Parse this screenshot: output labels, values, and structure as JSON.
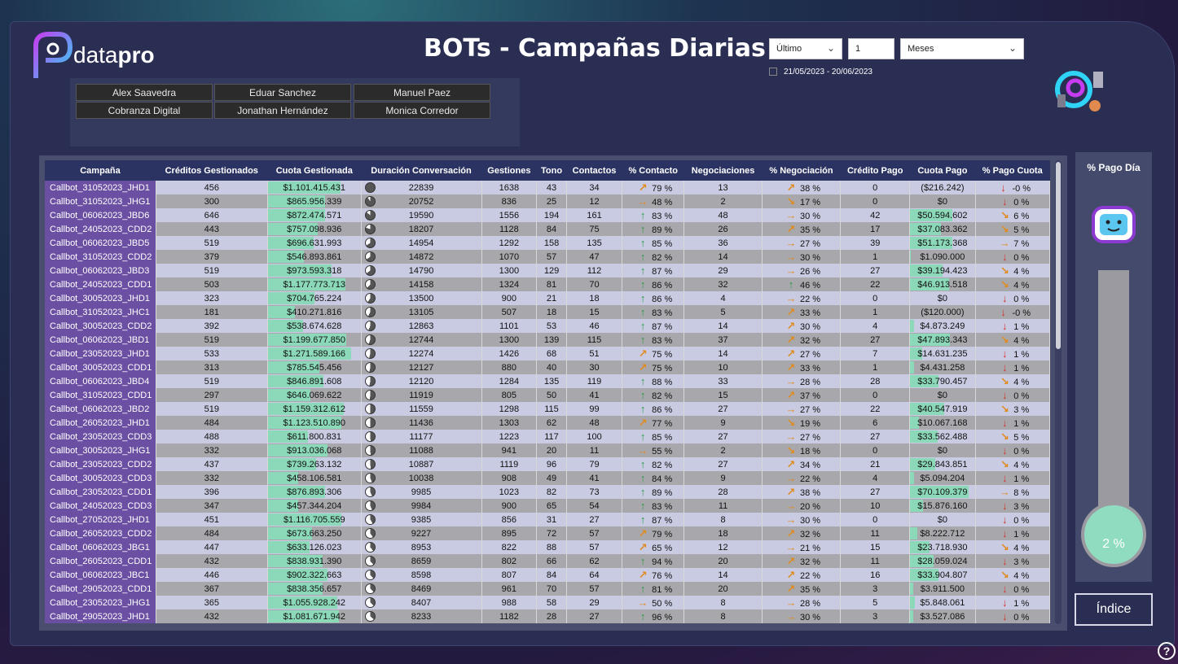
{
  "app": {
    "title": "BOTs - Campañas Diarias",
    "brand_left": "data",
    "brand_right": "pro"
  },
  "filters": {
    "period": "Último",
    "count": "1",
    "unit": "Meses",
    "daterange": "21/05/2023 - 20/06/2023"
  },
  "agents": [
    "Alex Saavedra",
    "Eduar Sanchez",
    "Manuel Paez",
    "Cobranza Digital",
    "Jonathan Hernández",
    "Monica Corredor"
  ],
  "table": {
    "headers": [
      "Campaña",
      "Créditos Gestionados",
      "Cuota Gestionada",
      "Duración Conversación",
      "Gestiones",
      "Tono",
      "Contactos",
      "% Contacto",
      "Negociaciones",
      "% Negociación",
      "Crédito Pago",
      "Cuota Pago",
      "% Pago Cuota"
    ],
    "rows": [
      [
        "Callbot_31052023_JHD1",
        "456",
        "$1.101.415.431",
        "22839",
        "1638",
        "43",
        "34",
        "ne",
        "79 %",
        "13",
        "ne",
        "38 %",
        "0",
        "($216.242)",
        "dn",
        "-0 %"
      ],
      [
        "Callbot_31052023_JHG1",
        "300",
        "$865.956.339",
        "20752",
        "836",
        "25",
        "12",
        "rt",
        "48 %",
        "2",
        "se",
        "17 %",
        "0",
        "$0",
        "dn",
        "0 %"
      ],
      [
        "Callbot_06062023_JBD6",
        "646",
        "$872.474.571",
        "19590",
        "1556",
        "194",
        "161",
        "up",
        "83 %",
        "48",
        "rt",
        "30 %",
        "42",
        "$50.594.602",
        "se",
        "6 %"
      ],
      [
        "Callbot_24052023_CDD2",
        "443",
        "$757.098.936",
        "18207",
        "1128",
        "84",
        "75",
        "up",
        "89 %",
        "26",
        "ne",
        "35 %",
        "17",
        "$37.083.362",
        "se",
        "5 %"
      ],
      [
        "Callbot_06062023_JBD5",
        "519",
        "$696.631.993",
        "14954",
        "1292",
        "158",
        "135",
        "up",
        "85 %",
        "36",
        "rt",
        "27 %",
        "39",
        "$51.173.368",
        "rt",
        "7 %"
      ],
      [
        "Callbot_31052023_CDD2",
        "379",
        "$546.893.861",
        "14872",
        "1070",
        "57",
        "47",
        "up",
        "82 %",
        "14",
        "rt",
        "30 %",
        "1",
        "$1.090.000",
        "dn",
        "0 %"
      ],
      [
        "Callbot_06062023_JBD3",
        "519",
        "$973.593.318",
        "14790",
        "1300",
        "129",
        "112",
        "up",
        "87 %",
        "29",
        "rt",
        "26 %",
        "27",
        "$39.194.423",
        "se",
        "4 %"
      ],
      [
        "Callbot_24052023_CDD1",
        "503",
        "$1.177.773.713",
        "14158",
        "1324",
        "81",
        "70",
        "up",
        "86 %",
        "32",
        "up",
        "46 %",
        "22",
        "$46.913.518",
        "se",
        "4 %"
      ],
      [
        "Callbot_30052023_JHD1",
        "323",
        "$704.765.224",
        "13500",
        "900",
        "21",
        "18",
        "up",
        "86 %",
        "4",
        "rt",
        "22 %",
        "0",
        "$0",
        "dn",
        "0 %"
      ],
      [
        "Callbot_31052023_JHC1",
        "181",
        "$410.271.816",
        "13105",
        "507",
        "18",
        "15",
        "up",
        "83 %",
        "5",
        "ne",
        "33 %",
        "1",
        "($120.000)",
        "dn",
        "-0 %"
      ],
      [
        "Callbot_30052023_CDD2",
        "392",
        "$538.674.628",
        "12863",
        "1101",
        "53",
        "46",
        "up",
        "87 %",
        "14",
        "ne",
        "30 %",
        "4",
        "$4.873.249",
        "dn",
        "1 %"
      ],
      [
        "Callbot_06062023_JBD1",
        "519",
        "$1.199.677.850",
        "12744",
        "1300",
        "139",
        "115",
        "up",
        "83 %",
        "37",
        "ne",
        "32 %",
        "27",
        "$47.893.343",
        "se",
        "4 %"
      ],
      [
        "Callbot_23052023_JHD1",
        "533",
        "$1.271.589.166",
        "12274",
        "1426",
        "68",
        "51",
        "ne",
        "75 %",
        "14",
        "ne",
        "27 %",
        "7",
        "$14.631.235",
        "dn",
        "1 %"
      ],
      [
        "Callbot_30052023_CDD1",
        "313",
        "$785.545.456",
        "12127",
        "880",
        "40",
        "30",
        "ne",
        "75 %",
        "10",
        "ne",
        "33 %",
        "1",
        "$4.431.258",
        "dn",
        "1 %"
      ],
      [
        "Callbot_06062023_JBD4",
        "519",
        "$846.891.608",
        "12120",
        "1284",
        "135",
        "119",
        "up",
        "88 %",
        "33",
        "rt",
        "28 %",
        "28",
        "$33.790.457",
        "se",
        "4 %"
      ],
      [
        "Callbot_31052023_CDD1",
        "297",
        "$646.069.622",
        "11919",
        "805",
        "50",
        "41",
        "up",
        "82 %",
        "15",
        "ne",
        "37 %",
        "0",
        "$0",
        "dn",
        "0 %"
      ],
      [
        "Callbot_06062023_JBD2",
        "519",
        "$1.159.312.612",
        "11559",
        "1298",
        "115",
        "99",
        "up",
        "86 %",
        "27",
        "rt",
        "27 %",
        "22",
        "$40.547.919",
        "se",
        "3 %"
      ],
      [
        "Callbot_26052023_JHD1",
        "484",
        "$1.123.510.890",
        "11436",
        "1303",
        "62",
        "48",
        "ne",
        "77 %",
        "9",
        "se",
        "19 %",
        "6",
        "$10.067.168",
        "dn",
        "1 %"
      ],
      [
        "Callbot_23052023_CDD3",
        "488",
        "$611.800.831",
        "11177",
        "1223",
        "117",
        "100",
        "up",
        "85 %",
        "27",
        "rt",
        "27 %",
        "27",
        "$33.562.488",
        "se",
        "5 %"
      ],
      [
        "Callbot_30052023_JHG1",
        "332",
        "$913.036.068",
        "11088",
        "941",
        "20",
        "11",
        "rt",
        "55 %",
        "2",
        "se",
        "18 %",
        "0",
        "$0",
        "dn",
        "0 %"
      ],
      [
        "Callbot_23052023_CDD2",
        "437",
        "$739.263.132",
        "10887",
        "1119",
        "96",
        "79",
        "up",
        "82 %",
        "27",
        "ne",
        "34 %",
        "21",
        "$29.843.851",
        "se",
        "4 %"
      ],
      [
        "Callbot_30052023_CDD3",
        "332",
        "$458.106.581",
        "10038",
        "908",
        "49",
        "41",
        "up",
        "84 %",
        "9",
        "rt",
        "22 %",
        "4",
        "$5.094.204",
        "dn",
        "1 %"
      ],
      [
        "Callbot_23052023_CDD1",
        "396",
        "$876.893.306",
        "9985",
        "1023",
        "82",
        "73",
        "up",
        "89 %",
        "28",
        "ne",
        "38 %",
        "27",
        "$70.109.379",
        "rt",
        "8 %"
      ],
      [
        "Callbot_24052023_CDD3",
        "347",
        "$457.344.204",
        "9984",
        "900",
        "65",
        "54",
        "up",
        "83 %",
        "11",
        "rt",
        "20 %",
        "10",
        "$15.876.160",
        "dn",
        "3 %"
      ],
      [
        "Callbot_27052023_JHD1",
        "451",
        "$1.116.705.559",
        "9385",
        "856",
        "31",
        "27",
        "up",
        "87 %",
        "8",
        "rt",
        "30 %",
        "0",
        "$0",
        "dn",
        "0 %"
      ],
      [
        "Callbot_26052023_CDD2",
        "484",
        "$673.663.250",
        "9227",
        "895",
        "72",
        "57",
        "ne",
        "79 %",
        "18",
        "ne",
        "32 %",
        "11",
        "$8.222.712",
        "dn",
        "1 %"
      ],
      [
        "Callbot_06062023_JBG1",
        "447",
        "$633.126.023",
        "8953",
        "822",
        "88",
        "57",
        "ne",
        "65 %",
        "12",
        "rt",
        "21 %",
        "15",
        "$23.718.930",
        "se",
        "4 %"
      ],
      [
        "Callbot_26052023_CDD1",
        "432",
        "$838.931.390",
        "8659",
        "802",
        "66",
        "62",
        "up",
        "94 %",
        "20",
        "ne",
        "32 %",
        "11",
        "$28.059.024",
        "dn",
        "3 %"
      ],
      [
        "Callbot_06062023_JBC1",
        "446",
        "$902.322.663",
        "8598",
        "807",
        "84",
        "64",
        "ne",
        "76 %",
        "14",
        "ne",
        "22 %",
        "16",
        "$33.904.807",
        "se",
        "4 %"
      ],
      [
        "Callbot_29052023_CDD1",
        "367",
        "$838.356.657",
        "8469",
        "961",
        "70",
        "57",
        "up",
        "81 %",
        "20",
        "ne",
        "35 %",
        "3",
        "$3.911.500",
        "dn",
        "0 %"
      ],
      [
        "Callbot_23052023_JHG1",
        "365",
        "$1.055.928.242",
        "8407",
        "988",
        "58",
        "29",
        "rt",
        "50 %",
        "8",
        "rt",
        "28 %",
        "5",
        "$5.848.061",
        "dn",
        "1 %"
      ],
      [
        "Callbot_29052023_JHD1",
        "432",
        "$1.081.671.942",
        "8233",
        "1182",
        "28",
        "27",
        "up",
        "96 %",
        "8",
        "rt",
        "30 %",
        "3",
        "$3.527.086",
        "dn",
        "0 %"
      ]
    ]
  },
  "gauge": {
    "title": "% Pago Día",
    "value_label": "2 %",
    "fill_fraction": 0.02
  },
  "buttons": {
    "indice": "Índice",
    "help": "?"
  },
  "colors": {
    "campaign_cell": "#6b4fa3",
    "bar_fill": "#8bd9b9",
    "header": "#2b3363",
    "up": "#2e9a4a",
    "warn": "#e08a1e",
    "down": "#d6322a"
  }
}
